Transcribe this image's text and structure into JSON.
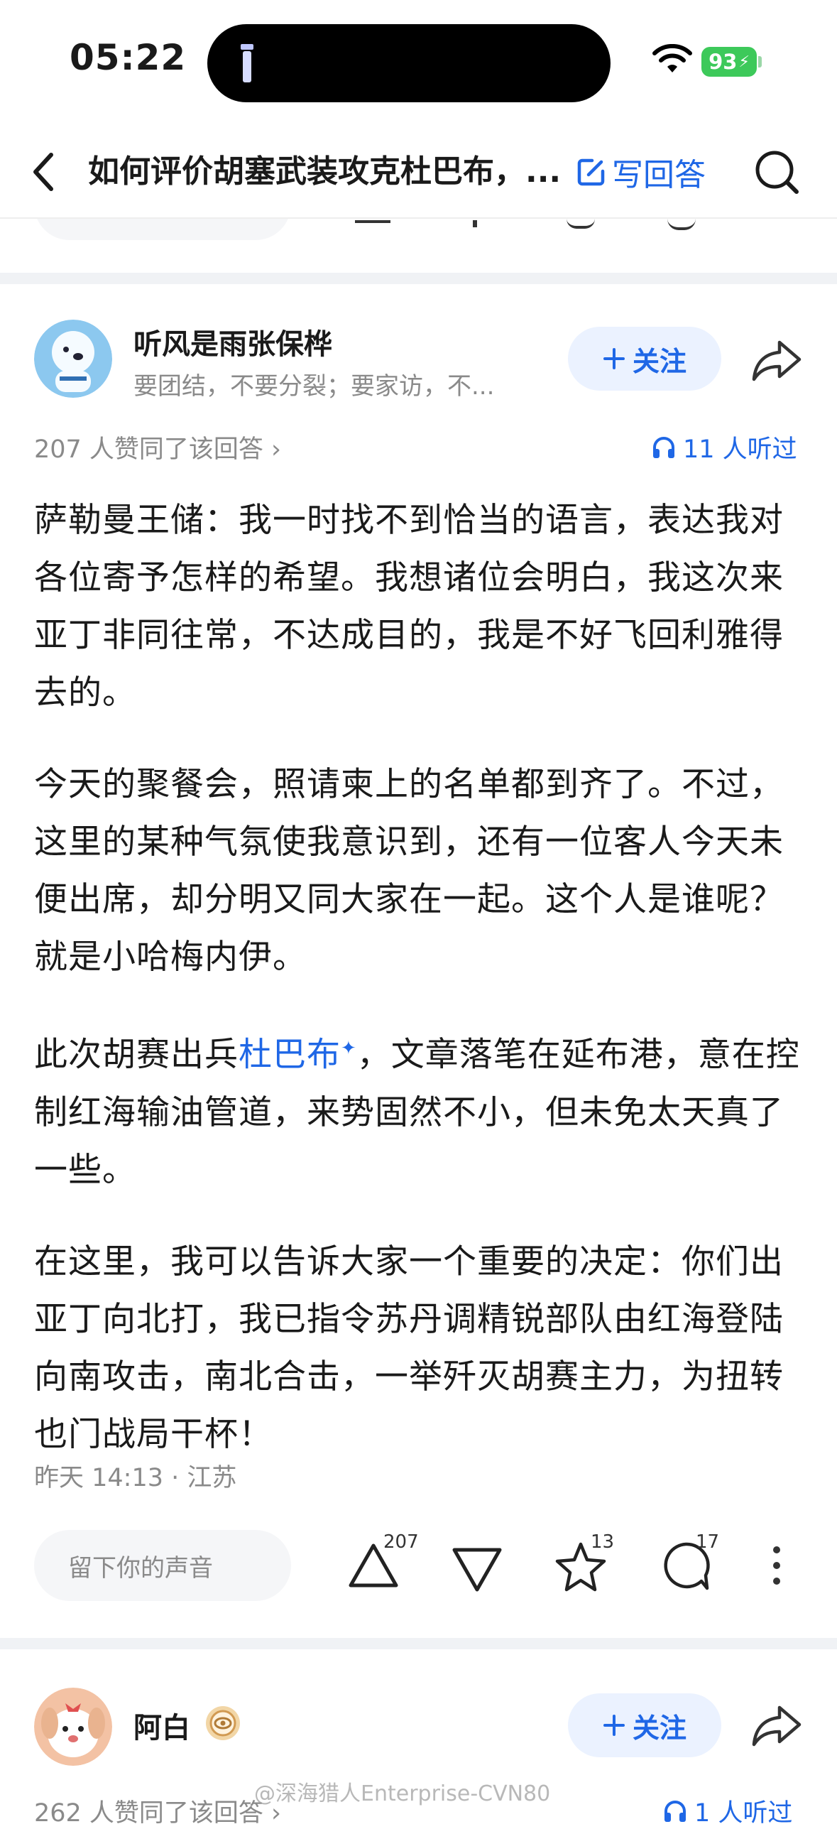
{
  "status_bar": {
    "time": "05:22",
    "battery": "93"
  },
  "nav": {
    "title": "如何评价胡塞武装攻克杜巴布，...",
    "write_answer": "写回答"
  },
  "answer1": {
    "author": "听风是雨张保桦",
    "signature": "要团结，不要分裂；要家访，不...",
    "follow": "关注",
    "upvote_line": "207 人赞同了该回答 ›",
    "listen": "11 人听过",
    "p1": "萨勒曼王储：我一时找不到恰当的语言，表达我对各位寄予怎样的希望。我想诸位会明白，我这次来亚丁非同往常，不达成目的，我是不好飞回利雅得去的。",
    "p2": "今天的聚餐会，照请柬上的名单都到齐了。不过，这里的某种气氛使我意识到，还有一位客人今天未便出席，却分明又同大家在一起。这个人是谁呢？就是小哈梅内伊。",
    "p3_before": "此次胡赛出兵",
    "p3_link": "杜巴布",
    "p3_after": "，文章落笔在延布港，意在控制红海输油管道，来势固然不小，但未免太天真了一些。",
    "p4": "在这里，我可以告诉大家一个重要的决定：你们出亚丁向北打，我已指令苏丹调精锐部队由红海登陆向南攻击，南北合击，一举歼灭胡赛主力，为扭转也门战局干杯！",
    "time_location": "昨天 14:13 · 江苏",
    "comment_placeholder": "留下你的声音",
    "upvotes": "207",
    "favorites": "13",
    "comments": "17"
  },
  "answer2": {
    "author": "阿白",
    "follow": "关注",
    "upvote_line": "262 人赞同了该回答 ›",
    "listen": "1 人听过"
  },
  "watermark": "@深海猎人Enterprise-CVN80",
  "colors": {
    "accent": "#1f67e6",
    "battery": "#3dc95a",
    "secondary_text": "#8a8a8a"
  },
  "icons": [
    "flashlight-icon",
    "wifi-icon",
    "back-icon",
    "edit-icon",
    "search-icon",
    "plus-icon",
    "share-icon",
    "headphones-icon",
    "upvote-icon",
    "downvote-icon",
    "star-icon",
    "comment-icon",
    "more-icon",
    "badge-icon"
  ]
}
